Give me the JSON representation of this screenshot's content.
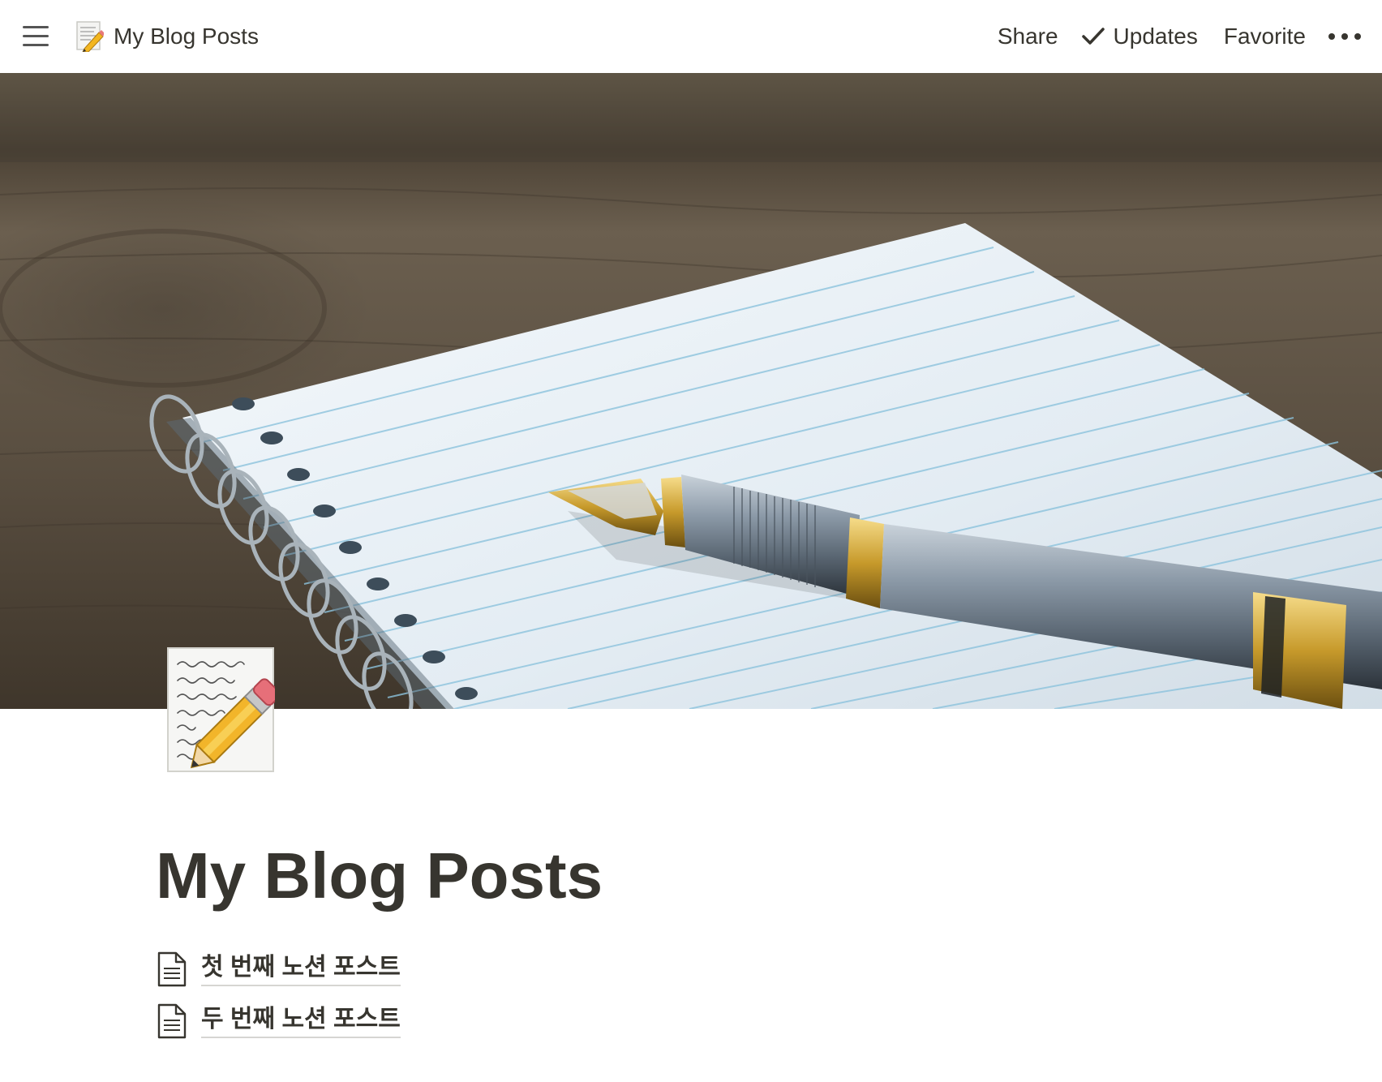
{
  "topbar": {
    "menu_icon": "hamburger-menu-icon",
    "breadcrumb": {
      "icon": "memo-icon",
      "title": "My Blog Posts"
    },
    "actions": {
      "share": "Share",
      "updates": "Updates",
      "updates_icon": "checkmark-icon",
      "favorite": "Favorite",
      "more_icon": "more-dots-icon"
    }
  },
  "cover": {
    "description_icon": "notebook-and-fountain-pen-cover"
  },
  "page": {
    "icon": "memo-icon",
    "title": "My Blog Posts",
    "subpages": [
      {
        "icon": "document-icon",
        "title": "첫 번째 노션 포스트"
      },
      {
        "icon": "document-icon",
        "title": "두 번째 노션 포스트"
      }
    ]
  },
  "colors": {
    "text": "#37352f",
    "link_underline": "#d6d5d2",
    "background": "#ffffff"
  }
}
